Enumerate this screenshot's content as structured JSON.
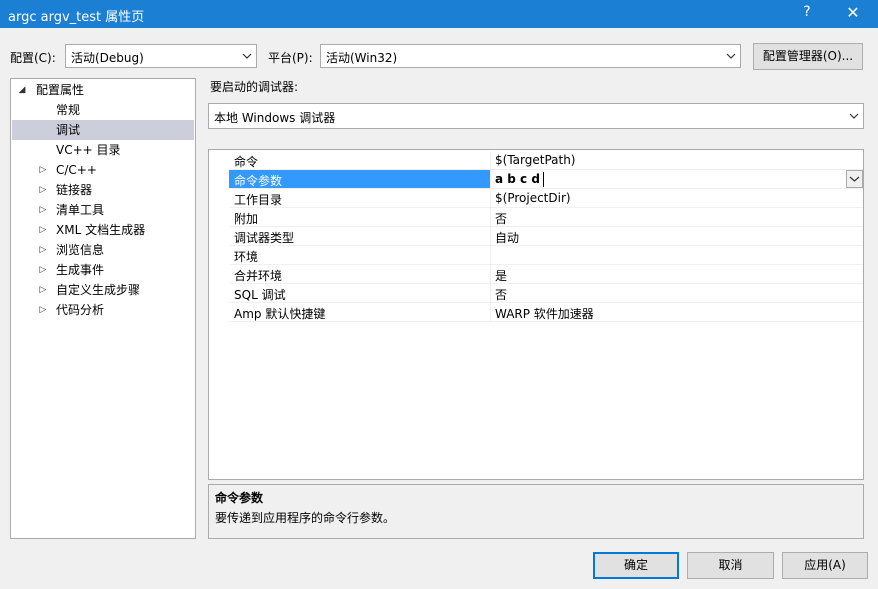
{
  "window": {
    "title": "argc argv_test 属性页",
    "help": "?",
    "close": "✕"
  },
  "config": {
    "label": "配置(C):",
    "value": "活动(Debug)"
  },
  "platform": {
    "label": "平台(P):",
    "value": "活动(Win32)"
  },
  "config_manager_button": "配置管理器(O)...",
  "tree": {
    "items": [
      {
        "label": "配置属性",
        "expander": "◢"
      },
      {
        "label": "常规"
      },
      {
        "label": "调试"
      },
      {
        "label": "VC++ 目录"
      },
      {
        "label": "C/C++",
        "expander": "▷"
      },
      {
        "label": "链接器",
        "expander": "▷"
      },
      {
        "label": "清单工具",
        "expander": "▷"
      },
      {
        "label": "XML 文档生成器",
        "expander": "▷"
      },
      {
        "label": "浏览信息",
        "expander": "▷"
      },
      {
        "label": "生成事件",
        "expander": "▷"
      },
      {
        "label": "自定义生成步骤",
        "expander": "▷"
      },
      {
        "label": "代码分析",
        "expander": "▷"
      }
    ],
    "selected": "调试"
  },
  "debugger": {
    "label": "要启动的调试器:",
    "value": "本地 Windows 调试器"
  },
  "properties": [
    {
      "name": "命令",
      "value": "$(TargetPath)"
    },
    {
      "name": "命令参数",
      "value": "a b c d"
    },
    {
      "name": "工作目录",
      "value": "$(ProjectDir)"
    },
    {
      "name": "附加",
      "value": "否"
    },
    {
      "name": "调试器类型",
      "value": "自动"
    },
    {
      "name": "环境",
      "value": ""
    },
    {
      "name": "合并环境",
      "value": "是"
    },
    {
      "name": "SQL 调试",
      "value": "否"
    },
    {
      "name": "Amp 默认快捷键",
      "value": "WARP 软件加速器"
    }
  ],
  "selected_property": "命令参数",
  "description": {
    "title": "命令参数",
    "text": "要传递到应用程序的命令行参数。"
  },
  "buttons": {
    "ok": "确定",
    "cancel": "取消",
    "apply": "应用(A)"
  },
  "colors": {
    "titlebar": "#1b7fd4",
    "selection": "#3399ff",
    "tree_selection": "#cccedb"
  }
}
